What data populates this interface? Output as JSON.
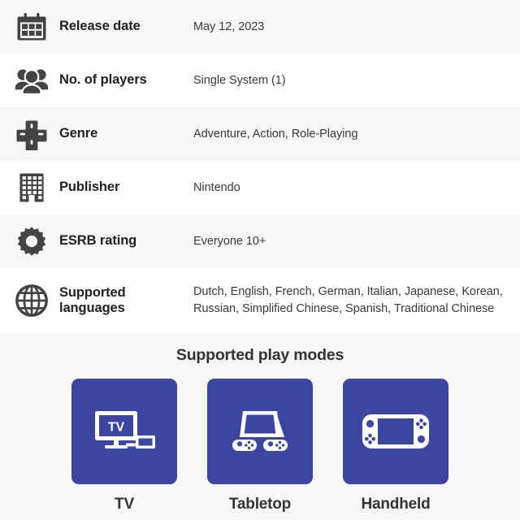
{
  "spec_rows": [
    {
      "icon": "calendar-icon",
      "label": "Release date",
      "value": "May 12, 2023"
    },
    {
      "icon": "players-group-icon",
      "label": "No. of players",
      "value": "Single System (1)"
    },
    {
      "icon": "dpad-icon",
      "label": "Genre",
      "value": "Adventure, Action, Role-Playing"
    },
    {
      "icon": "building-icon",
      "label": "Publisher",
      "value": "Nintendo"
    },
    {
      "icon": "gear-icon",
      "label": "ESRB rating",
      "value": "Everyone 10+"
    },
    {
      "icon": "globe-icon",
      "label": "Supported languages",
      "value": "Dutch, English, French, German, Italian, Japanese, Korean, Russian, Simplified Chinese, Spanish, Traditional Chinese"
    }
  ],
  "play_modes": {
    "title": "Supported play modes",
    "card_color": "#3c46a0",
    "modes": [
      {
        "icon": "tv-mode-icon",
        "label": "TV",
        "screen_text": "TV"
      },
      {
        "icon": "tabletop-mode-icon",
        "label": "Tabletop"
      },
      {
        "icon": "handheld-mode-icon",
        "label": "Handheld"
      }
    ]
  },
  "colors": {
    "row_alt_background": "#f7f7f7",
    "row_background": "#ffffff",
    "label_text": "#222222",
    "value_text": "#3a3a3a",
    "icon_fill": "#444444"
  }
}
